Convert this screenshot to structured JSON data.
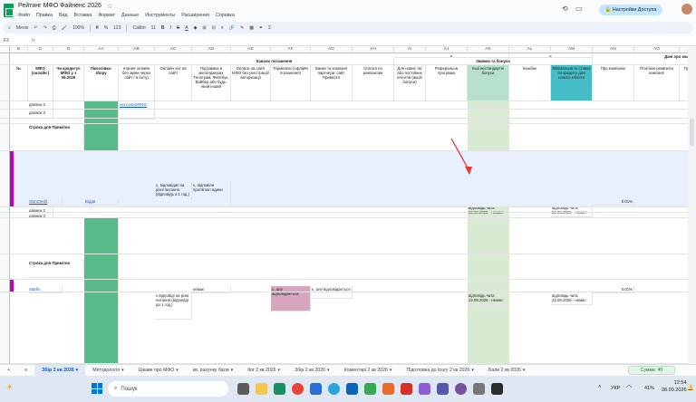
{
  "window": {
    "title": "Рейтинг МФО Файненс 2026",
    "share": "Настройки Доступа"
  },
  "menu": [
    "Файл",
    "Правка",
    "Вид",
    "Вставка",
    "Формат",
    "Данные",
    "Инструменты",
    "Расширения",
    "Справка"
  ],
  "toolbar": {
    "menus": "Меню",
    "zoom": "100%",
    "format": "123",
    "font": "Calibri",
    "size": "11"
  },
  "formula": {
    "ref": "F3",
    "fx": "fx"
  },
  "columns": [
    "A",
    "B",
    "C",
    "D",
    "AA",
    "AB",
    "AC",
    "AD",
    "AE",
    "AF",
    "AG",
    "AH",
    "AI",
    "AJ",
    "AK",
    "AL",
    "AM",
    "AN",
    "AO",
    "AP",
    "AQ"
  ],
  "header": {
    "no": "№",
    "mfo": "МФО (онлайн )",
    "credit": "Чи кредитує МФО у з 06.2026",
    "score": "Пікселівка-збору",
    "group1": "Канали погашення",
    "group2": "Знижки та бонуси",
    "group3": "Дані про компанію",
    "num5": "5",
    "num6": "6",
    "cols": [
      "етання онлайн без зміни через сайт / в боту)",
      "Онлайн чат на сайті",
      "Підтримка в месенджерах Телеграм, Фейсбук, Вайбер або будь-який інший",
      "Оплата на сайті МФО без реєстрації/авторизації",
      "Термінали (офлайн погашення)",
      "Банки та компанії партнери, сайт Приват24",
      "Оплата по реквізитам",
      "Для нових та/або постійних клієнтів (акції/бонуси)",
      "Реферальна програма",
      "Інші нестандартні бонуси",
      "Кешбек",
      "Мінімальна % ставка по кредиту для нового клієнта",
      "Про компанію",
      "Платіжні реквізити компанії",
      "Про надану кредиту",
      "Про політику в блоці Питання/поради"
    ]
  },
  "rows": {
    "r1": {
      "label": "Строка для Примітки",
      "links": "net.com/d-RNG",
      "s": "dzavdan 2"
    },
    "r2": "дзвінок 2",
    "r3": "дзвінок 3",
    "sloncredit": {
      "name": "SlonCredit",
      "status": "Віддв",
      "time": "є, відповідає на різні питання (відповідь в 1 год.)",
      "note": "є, відповіли протягом години",
      "date": "відповідь чата 22.08.2026 - немає:",
      "pct": "0.01%"
    },
    "startfin": {
      "name": "Starfin",
      "time": "є відповіді на різні питання (відповіді до 1 год.)",
      "no": "немає",
      "ans": "є, але відповідається",
      "date": "відповідь чата 22.08.2026 - немає:",
      "pct": "0.01%"
    }
  },
  "sheets": [
    "Збір 3 кв 2026",
    "Методологія",
    "Цікаве про МФО",
    "кв. рахунку бали",
    "Itor 2 кв 2026",
    "Збір 2 кв 2026",
    "Коментарі 2 кв 2026",
    "Підготовка до toury 2 кв 2026",
    "Бали 2 кв 2026"
  ],
  "sum": "Сумма: 40",
  "taskbar": {
    "search": "Пошук",
    "lang": "УКР",
    "battery": "41%",
    "time": "12:54",
    "date": "28.09.2026"
  }
}
